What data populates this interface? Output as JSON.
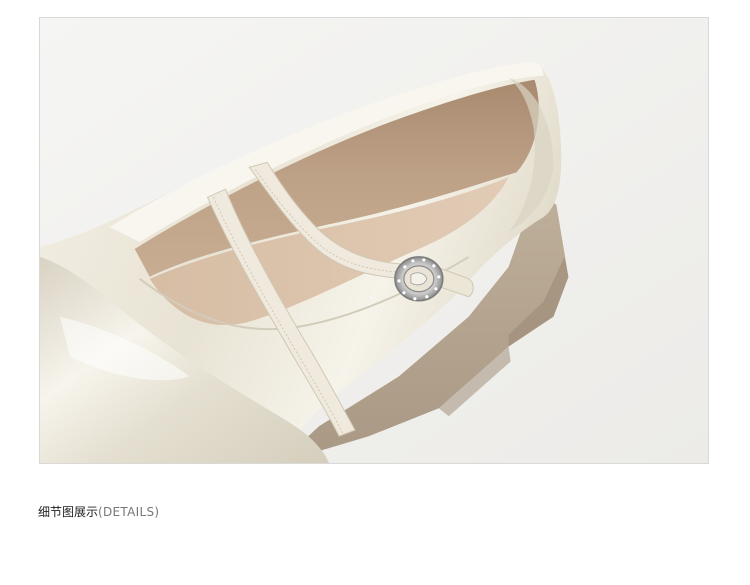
{
  "caption": {
    "cn": "细节图展示",
    "en": "(DETAILS)"
  },
  "colors": {
    "background": "#ffffff",
    "frame_border": "#d9d9d9",
    "backdrop": "#f1f1ef",
    "patent_leather": "#ebe6d8",
    "lining": "#b89a7e",
    "insole": "#dcc3ab",
    "sole": "#b5a58f",
    "buckle": "#cfcfcf"
  }
}
